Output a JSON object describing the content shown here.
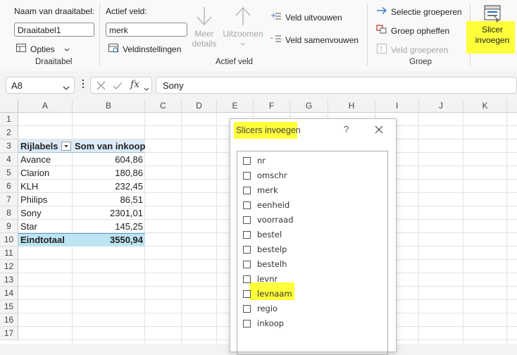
{
  "ribbon": {
    "draaitabel": {
      "name_label": "Naam van draaitabel:",
      "name_value": "Draaitabel1",
      "options_label": "Opties",
      "group_label": "Draaitabel"
    },
    "actief_veld": {
      "field_label": "Actief veld:",
      "field_value": "merk",
      "settings_label": "Veldinstellingen",
      "drill_down_label": "Meer\ndetails",
      "drill_up_label": "Uitzoomen",
      "expand_label": "Veld uitvouwen",
      "collapse_label": "Veld samenvouwen",
      "group_label": "Actief veld"
    },
    "groep": {
      "group_selection_label": "Selectie groeperen",
      "ungroup_label": "Groep opheffen",
      "group_field_label": "Veld groeperen",
      "group_label": "Groep"
    },
    "slicer": {
      "label_line1": "Slicer",
      "label_line2": "invoegen"
    }
  },
  "formula_bar": {
    "name_box": "A8",
    "fx": "fx",
    "formula": "Sony"
  },
  "grid": {
    "columns": [
      "A",
      "B",
      "C",
      "D",
      "E",
      "F",
      "G",
      "H",
      "I",
      "J",
      "K"
    ],
    "rows": [
      "1",
      "2",
      "3",
      "4",
      "5",
      "6",
      "7",
      "8",
      "9",
      "10",
      "11",
      "12",
      "13",
      "14",
      "15",
      "16",
      "17"
    ],
    "pivot": {
      "header_label": "Rijlabels",
      "header_value": "Som van inkoop",
      "rows": [
        {
          "label": "Avance",
          "value": "604,86"
        },
        {
          "label": "Clarion",
          "value": "180,86"
        },
        {
          "label": "KLH",
          "value": "232,45"
        },
        {
          "label": "Philips",
          "value": "86,51"
        },
        {
          "label": "Sony",
          "value": "2301,01"
        },
        {
          "label": "Star",
          "value": "145,25"
        }
      ],
      "total_label": "Eindtotaal",
      "total_value": "3550,94"
    }
  },
  "dialog": {
    "title": "Slicers invoegen",
    "help": "?",
    "fields": [
      "nr",
      "omschr",
      "merk",
      "eenheid",
      "voorraad",
      "bestel",
      "bestelp",
      "bestelh",
      "levnr",
      "levnaam",
      "regio",
      "inkoop"
    ]
  },
  "colors": {
    "highlight": "#ffff3a",
    "pivot_header": "#ddebf7",
    "pivot_total": "#bde4f3",
    "accent_blue": "#1e6fbf"
  }
}
